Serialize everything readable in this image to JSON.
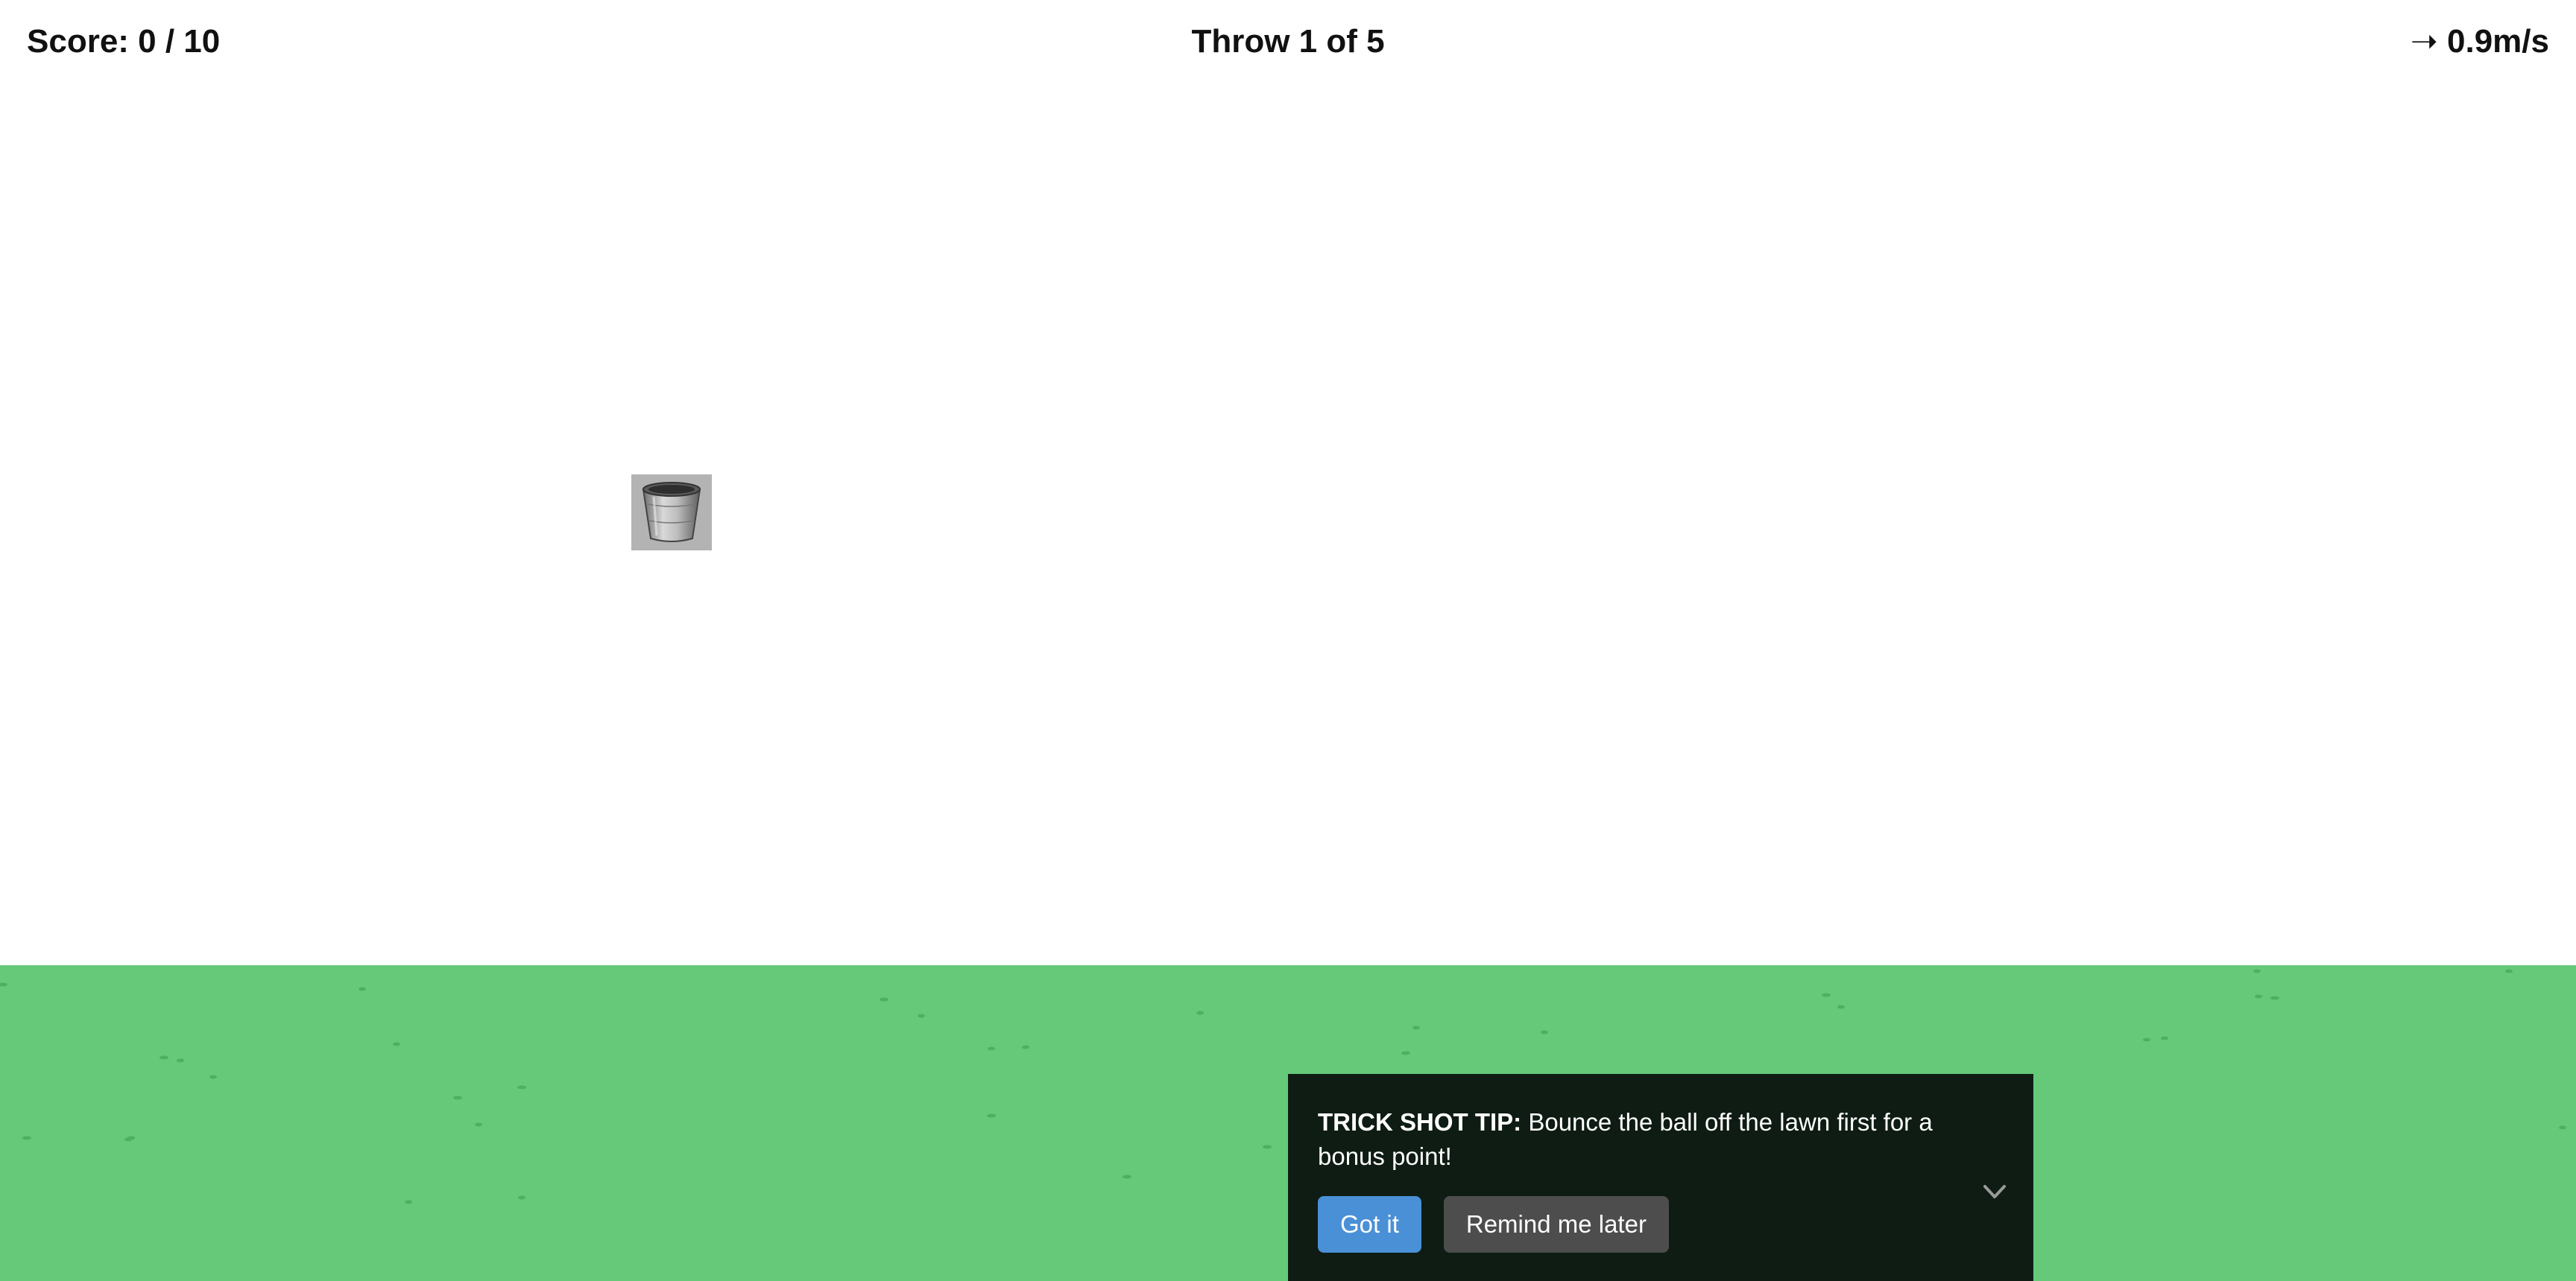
{
  "hud": {
    "score": "Score: 0 / 10",
    "throw": "Throw 1 of 5",
    "wind": "➝ 0.9m/s"
  },
  "tip": {
    "heading": "TRICK SHOT TIP:",
    "body": " Bounce the ball off the lawn first for a bonus point!",
    "got_it_label": "Got it",
    "remind_label": "Remind me later"
  },
  "colors": {
    "lawn": "#66c97a",
    "grass_tuft": "#4fae63",
    "tip_panel": "#0e1c14",
    "primary_button": "#4a90d6",
    "secondary_button": "#4d4d4d"
  },
  "icons": {
    "bucket": "bucket-icon",
    "collapse": "chevron-down-icon"
  }
}
